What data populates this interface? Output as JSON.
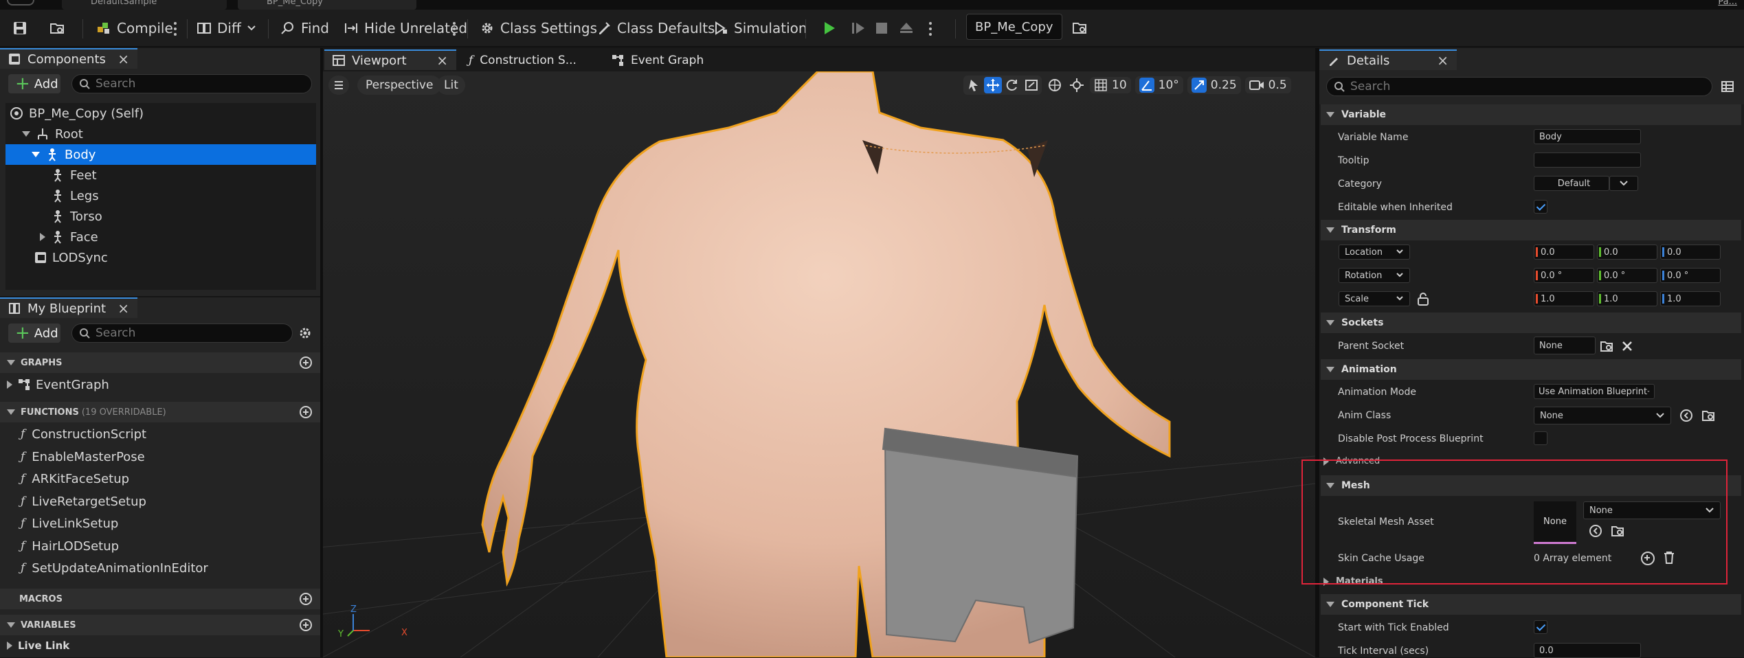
{
  "top_tabs": [
    "DefaultSample",
    "BP_Me_Copy"
  ],
  "window_right_text": "Pa...",
  "toolbar": {
    "compile": "Compile",
    "diff": "Diff",
    "find": "Find",
    "hide_unrelated": "Hide Unrelated",
    "class_settings": "Class Settings",
    "class_defaults": "Class Defaults",
    "simulation": "Simulation",
    "debug_object": "BP_Me_Copy"
  },
  "components": {
    "tab": "Components",
    "add": "Add",
    "search_placeholder": "Search",
    "tree": {
      "self": "BP_Me_Copy (Self)",
      "root": "Root",
      "body": "Body",
      "feet": "Feet",
      "legs": "Legs",
      "torso": "Torso",
      "face": "Face",
      "lodsync": "LODSync"
    }
  },
  "my_blueprint": {
    "tab": "My Blueprint",
    "add": "Add",
    "search_placeholder": "Search",
    "graphs_header": "GRAPHS",
    "event_graph": "EventGraph",
    "functions_header": "FUNCTIONS",
    "functions_count": "(19 OVERRIDABLE)",
    "functions": [
      "ConstructionScript",
      "EnableMasterPose",
      "ARKitFaceSetup",
      "LiveRetargetSetup",
      "LiveLinkSetup",
      "HairLODSetup",
      "SetUpdateAnimationInEditor"
    ],
    "macros_header": "MACROS",
    "variables_header": "VARIABLES",
    "live_link": "Live Link"
  },
  "center_tabs": {
    "viewport": "Viewport",
    "construction": "Construction S...",
    "event_graph": "Event Graph"
  },
  "viewport": {
    "perspective": "Perspective",
    "lit": "Lit",
    "grid_snap": "10",
    "rot_snap": "10°",
    "scale_snap": "0.25",
    "cam_speed": "0.5"
  },
  "details": {
    "tab": "Details",
    "search_placeholder": "Search",
    "variable_header": "Variable",
    "variable_name_label": "Variable Name",
    "variable_name_value": "Body",
    "tooltip_label": "Tooltip",
    "category_label": "Category",
    "category_value": "Default",
    "editable_label": "Editable when Inherited",
    "transform_header": "Transform",
    "location": "Location",
    "rotation": "Rotation",
    "scale": "Scale",
    "loc": [
      "0.0",
      "0.0",
      "0.0"
    ],
    "rot": [
      "0.0 °",
      "0.0 °",
      "0.0 °"
    ],
    "scl": [
      "1.0",
      "1.0",
      "1.0"
    ],
    "sockets_header": "Sockets",
    "parent_socket_label": "Parent Socket",
    "parent_socket_value": "None",
    "animation_header": "Animation",
    "animation_mode_label": "Animation Mode",
    "animation_mode_value": "Use Animation Blueprint",
    "anim_class_label": "Anim Class",
    "anim_class_value": "None",
    "disable_pp_label": "Disable Post Process Blueprint",
    "advanced": "Advanced",
    "mesh_header": "Mesh",
    "skeletal_mesh_label": "Skeletal Mesh Asset",
    "skeletal_mesh_thumb": "None",
    "skeletal_mesh_value": "None",
    "skin_cache_label": "Skin Cache Usage",
    "skin_cache_value": "0 Array element",
    "materials": "Materials",
    "component_tick_header": "Component Tick",
    "start_tick_label": "Start with Tick Enabled",
    "tick_interval_label": "Tick Interval (secs)",
    "tick_interval_value": "0.0"
  },
  "colors": {
    "accent": "#1e6fd9",
    "play": "#45c340",
    "highlight_box": "#e0243a",
    "selection_outline": "#f0a21e"
  }
}
